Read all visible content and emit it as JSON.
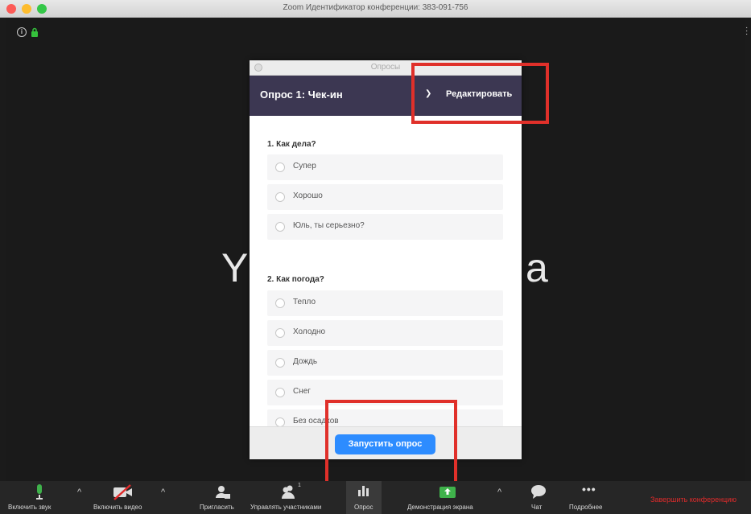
{
  "window": {
    "title": "Zoom Идентификатор конференции: 383-091-756"
  },
  "meeting": {
    "name_left": "Y",
    "name_right": "a"
  },
  "poll_window": {
    "title": "Опросы",
    "poll_name": "Опрос 1: Чек-ин",
    "edit_label": "Редактировать",
    "questions": [
      {
        "text": "1. Как дела?",
        "options": [
          "Супер",
          "Хорошо",
          "Юль, ты серьезно?"
        ]
      },
      {
        "text": "2. Как погода?",
        "options": [
          "Тепло",
          "Холодно",
          "Дождь",
          "Снег",
          "Без осадков"
        ]
      }
    ],
    "launch_label": "Запустить опрос"
  },
  "toolbar": {
    "unmute_label": "Включить звук",
    "video_label": "Включить видео",
    "invite_label": "Пригласить",
    "participants_label": "Управлять участниками",
    "participants_count": "1",
    "poll_label": "Опрос",
    "share_label": "Демонстрация экрана",
    "chat_label": "Чат",
    "more_label": "Подробнее",
    "end_label": "Завершить конференцию"
  },
  "colors": {
    "accent_blue": "#2d8cff",
    "poll_header": "#3c3752",
    "highlight_red": "#e0302a",
    "end_red": "#e02b2b",
    "share_green": "#3fb24b"
  }
}
